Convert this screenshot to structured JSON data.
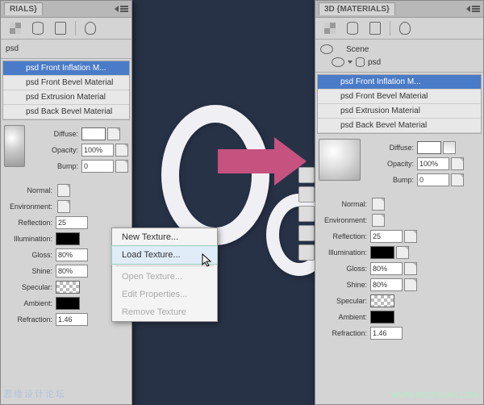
{
  "panel_left": {
    "title": "RIALS}"
  },
  "panel_right": {
    "title": "3D {MATERIALS}"
  },
  "scene": {
    "label": "Scene",
    "psd_label": "psd"
  },
  "label_psd": "psd",
  "materials": [
    {
      "name": "psd Front Inflation M...",
      "selected": true
    },
    {
      "name": "psd Front Bevel Material",
      "selected": false
    },
    {
      "name": "psd Extrusion Material",
      "selected": false
    },
    {
      "name": "psd Back Bevel Material",
      "selected": false
    }
  ],
  "props": {
    "diffuse": "Diffuse:",
    "opacity": "Opacity:",
    "opacity_val": "100%",
    "bump": "Bump:",
    "bump_val": "0",
    "normal": "Normal:",
    "environment": "Environment:",
    "reflection": "Reflection:",
    "reflection_val": "25",
    "illumination": "Illumination:",
    "gloss": "Gloss:",
    "gloss_val": "80%",
    "shine": "Shine:",
    "shine_val": "80%",
    "specular": "Specular:",
    "ambient": "Ambient:",
    "refraction": "Refraction:",
    "refraction_val": "1.46"
  },
  "context_menu": {
    "new_texture": "New Texture...",
    "load_texture": "Load Texture...",
    "open_texture": "Open Texture...",
    "edit_properties": "Edit Properties...",
    "remove_texture": "Remove Texture"
  },
  "watermark": "思缘设计论坛",
  "url": "WWW.MISSYUAN.COM"
}
